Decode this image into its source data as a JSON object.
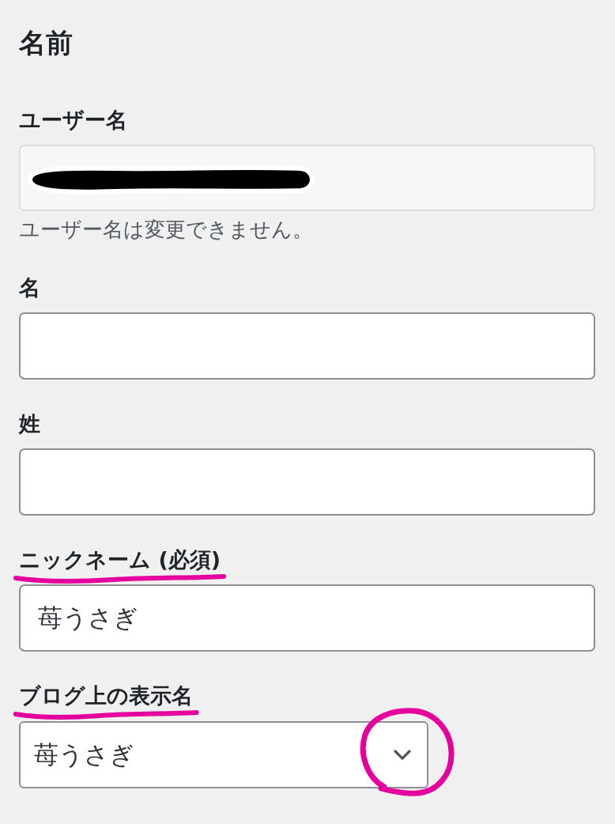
{
  "section": {
    "title": "名前"
  },
  "fields": [
    {
      "kind": "readonly",
      "label": "ユーザー名",
      "redacted": true,
      "hint": "ユーザー名は変更できません。",
      "label_underlined": false
    },
    {
      "kind": "text",
      "label": "名",
      "label_underlined": false
    },
    {
      "kind": "text",
      "label": "姓",
      "label_underlined": false
    },
    {
      "kind": "text",
      "label": "ニックネーム (必須)",
      "value": "苺うさぎ",
      "label_underlined": true
    },
    {
      "kind": "select",
      "label": "ブログ上の表示名",
      "value": "苺うさぎ",
      "label_underlined": true,
      "caret_circled": true
    }
  ]
}
